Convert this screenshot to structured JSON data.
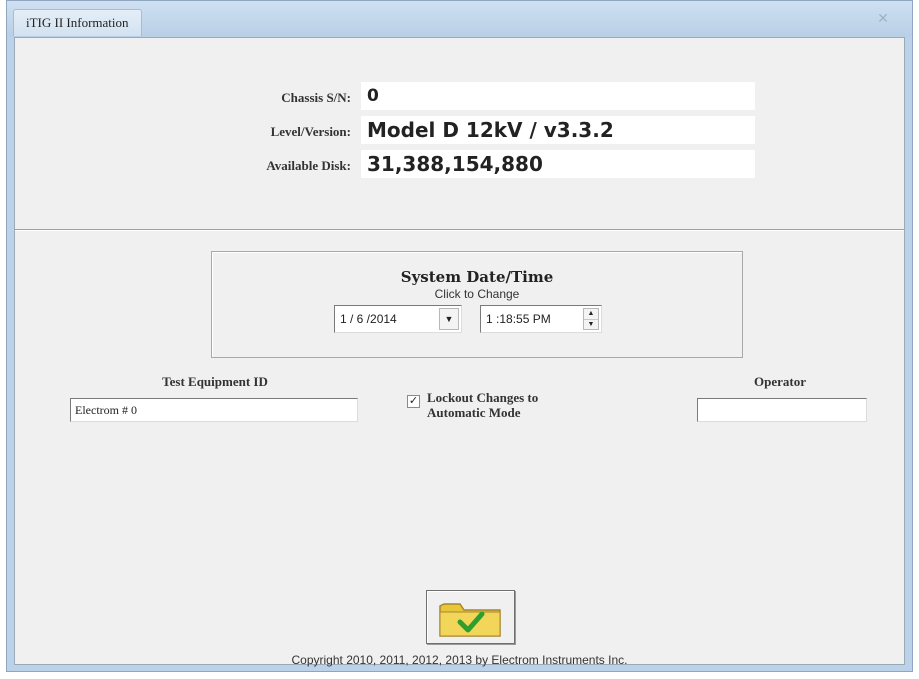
{
  "window": {
    "title": "iTIG II Information"
  },
  "info": {
    "chassis_label": "Chassis S/N:",
    "chassis_value": "0",
    "level_label": "Level/Version:",
    "level_value": "Model D 12kV / v3.3.2",
    "disk_label": "Available Disk:",
    "disk_value": "31,388,154,880"
  },
  "datetime": {
    "title": "System Date/Time",
    "subtitle": "Click to Change",
    "date": "1 / 6 /2014",
    "time": "1 :18:55 PM"
  },
  "test_equipment": {
    "label": "Test Equipment ID",
    "value": "Electrom # 0"
  },
  "lockout": {
    "label_line1": "Lockout Changes to",
    "label_line2": "Automatic Mode",
    "checked": true
  },
  "operator": {
    "label": "Operator",
    "value": ""
  },
  "footer": {
    "copyright": "Copyright 2010, 2011, 2012, 2013 by Electrom Instruments Inc."
  },
  "colors": {
    "window_frame": "#bcd2e8",
    "client_bg": "#f0f0f0",
    "checkmark_green": "#2e9e2e",
    "folder_yellow": "#e8c63a"
  },
  "icons": {
    "ok_button": "folder-check-icon",
    "date_dropdown": "chevron-down-icon",
    "time_spinner": "spinner-icon"
  }
}
